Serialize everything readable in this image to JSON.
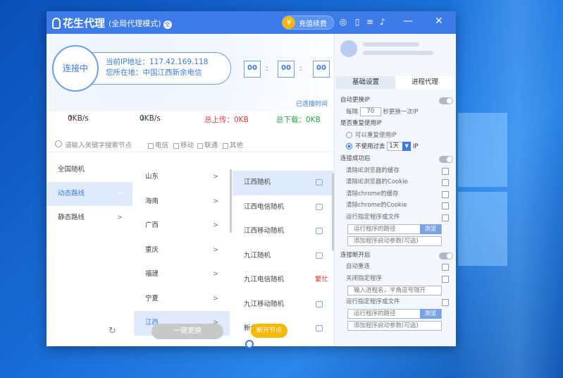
{
  "app": {
    "logo": "花生代理",
    "mode": "(全局代理模式)",
    "mode_badge": "全",
    "recharge": "充值续费",
    "coin": "¥"
  },
  "status": {
    "connect_label": "连接中",
    "current_ip": "当前IP地址：117.42.169.118",
    "location": "您所在地：中国江西新余电信",
    "time": [
      "00",
      "00",
      "00"
    ],
    "connected_time_label": "已连接时间",
    "up_speed": "0KB/s",
    "down_speed": "0KB/s",
    "total_up": "总上传：0KB",
    "total_down": "总下载：0KB"
  },
  "search": {
    "placeholder": "请输入关键字搜索节点",
    "filters": [
      "电信",
      "移动",
      "联通",
      "其他"
    ]
  },
  "route_types": [
    {
      "label": "全国随机",
      "arrow": ""
    },
    {
      "label": "动态路线",
      "arrow": ">"
    },
    {
      "label": "静态路线",
      "arrow": ">"
    }
  ],
  "provinces": [
    {
      "label": "山东",
      "arrow": ">"
    },
    {
      "label": "海南",
      "arrow": ">"
    },
    {
      "label": "广西",
      "arrow": ">"
    },
    {
      "label": "重庆",
      "arrow": ">"
    },
    {
      "label": "福建",
      "arrow": ">"
    },
    {
      "label": "宁夏",
      "arrow": ">"
    },
    {
      "label": "江西",
      "arrow": ">"
    }
  ],
  "nodes": [
    {
      "label": "江西随机",
      "busy": ""
    },
    {
      "label": "江西电信随机",
      "busy": ""
    },
    {
      "label": "江西移动随机",
      "busy": ""
    },
    {
      "label": "九江随机",
      "busy": ""
    },
    {
      "label": "九江电信随机",
      "busy": "繁忙"
    },
    {
      "label": "九江移动随机",
      "busy": ""
    },
    {
      "label": "新余随机",
      "busy": ""
    }
  ],
  "actions": {
    "refresh": "↻",
    "one_key": "一键更换",
    "open_node": "断开节点"
  },
  "right": {
    "tab_basic": "基础设置",
    "tab_process": "进程代理",
    "auto_change": "自动更换IP",
    "every": "每隔",
    "seconds_value": "70",
    "seconds_suffix": "秒更换一次IP",
    "reuse": "是否重复使用IP",
    "reuse_yes": "可以重复使用IP",
    "reuse_no_prefix": "不使用过去",
    "reuse_days": "1天",
    "reuse_no_suffix": "IP",
    "after_connect": "连接成功后",
    "clear_ie_cache": "清除IE浏览器的缓存",
    "clear_ie_cookie": "清除IE浏览器的Cookie",
    "clear_chrome_cache": "清除chrome的缓存",
    "clear_chrome_cookie": "清除chrome的Cookie",
    "run_program": "运行指定程序或文件",
    "program_path": "运行程序的路径",
    "browse": "浏览",
    "add_params": "添加程序启动参数(可选)",
    "after_disconnect": "连接断开后",
    "auto_reconnect": "自动重连",
    "close_program": "关闭指定程序",
    "process_name": "输入进程名，半角逗号隔开",
    "run_program2": "运行指定程序或文件",
    "program_path2": "运行程序的路径",
    "browse2": "浏览",
    "add_params2": "添加程序启动参数(可选)"
  },
  "colors": {
    "accent": "#3d7be8",
    "busy": "#e03a3a",
    "open_node": "#f6b800"
  }
}
